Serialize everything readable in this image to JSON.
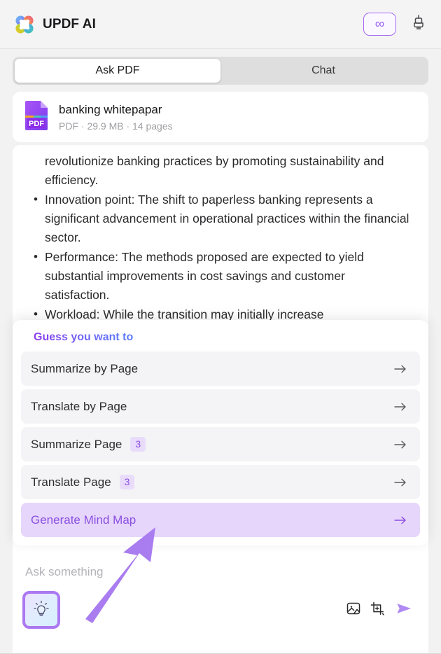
{
  "header": {
    "app_title": "UPDF AI",
    "logo_icon": "updf-clover-logo",
    "infinity_label": "∞",
    "infinity_icon": "infinity-icon",
    "brush_icon": "brush-icon"
  },
  "tabs": [
    {
      "label": "Ask PDF",
      "active": true
    },
    {
      "label": "Chat",
      "active": false
    }
  ],
  "file": {
    "name": "banking whitepapar",
    "meta": "PDF · 29.9 MB · 14 pages",
    "icon": "pdf-file-icon",
    "badge_text": "PDF"
  },
  "document": {
    "paragraph": "revolutionize banking practices by promoting sustainability and efficiency.",
    "bullets": [
      "Innovation point: The shift to paperless banking represents a significant advancement in operational practices within the financial sector.",
      "Performance: The methods proposed are expected to yield substantial improvements in cost savings and customer satisfaction.",
      "Workload: While the transition may initially increase"
    ]
  },
  "suggestions": {
    "title": "Guess you want to",
    "items": [
      {
        "label": "Summarize by Page",
        "badge": "",
        "highlight": false
      },
      {
        "label": "Translate by Page",
        "badge": "",
        "highlight": false
      },
      {
        "label": "Summarize Page",
        "badge": "3",
        "highlight": false
      },
      {
        "label": "Translate Page",
        "badge": "3",
        "highlight": false
      },
      {
        "label": "Generate Mind Map",
        "badge": "",
        "highlight": true
      }
    ],
    "row_arrow_icon": "arrow-right-icon"
  },
  "composer": {
    "placeholder": "Ask something",
    "value": "",
    "bulb_icon": "lightbulb-icon",
    "image_icon": "image-icon",
    "scan_icon": "scan-area-icon",
    "send_icon": "send-icon"
  },
  "annotation": {
    "arrow_icon": "pointer-arrow-annotation",
    "color": "#a97cf0"
  },
  "colors": {
    "accent": "#9b62ef",
    "highlight_bg": "#e6d6fb",
    "page_bg": "#f2f2f3",
    "card_bg": "#ffffff",
    "row_bg": "#f4f4f6"
  }
}
